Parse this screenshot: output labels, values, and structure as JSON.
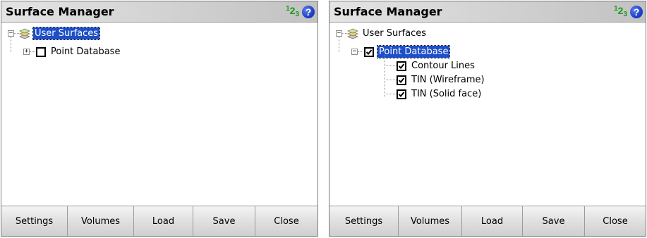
{
  "screens": [
    {
      "title": "Surface Manager",
      "input_mode": {
        "sup": "1",
        "main": "2",
        "sub": "3"
      },
      "help_glyph": "?",
      "tree": {
        "root": {
          "label": "User Surfaces",
          "expander": "−",
          "icon": "layers-icon",
          "selected": true
        },
        "point_database": {
          "label": "Point Database",
          "expander": "+",
          "checked": false
        }
      },
      "buttons": [
        "Settings",
        "Volumes",
        "Load",
        "Save",
        "Close"
      ]
    },
    {
      "title": "Surface Manager",
      "input_mode": {
        "sup": "1",
        "main": "2",
        "sub": "3"
      },
      "help_glyph": "?",
      "tree": {
        "root": {
          "label": "User Surfaces",
          "expander": "−",
          "icon": "layers-icon",
          "selected": false
        },
        "point_database": {
          "label": "Point Database",
          "expander": "−",
          "checked": true,
          "selected": true
        },
        "children": [
          {
            "label": "Contour Lines",
            "checked": true
          },
          {
            "label": "TIN (Wireframe)",
            "checked": true
          },
          {
            "label": "TIN (Solid face)",
            "checked": true
          }
        ]
      },
      "buttons": [
        "Settings",
        "Volumes",
        "Load",
        "Save",
        "Close"
      ]
    }
  ],
  "colors": {
    "selection": "#1c4fc8",
    "input_mode": "#1a9a1a",
    "help": "#1e3fc8"
  }
}
